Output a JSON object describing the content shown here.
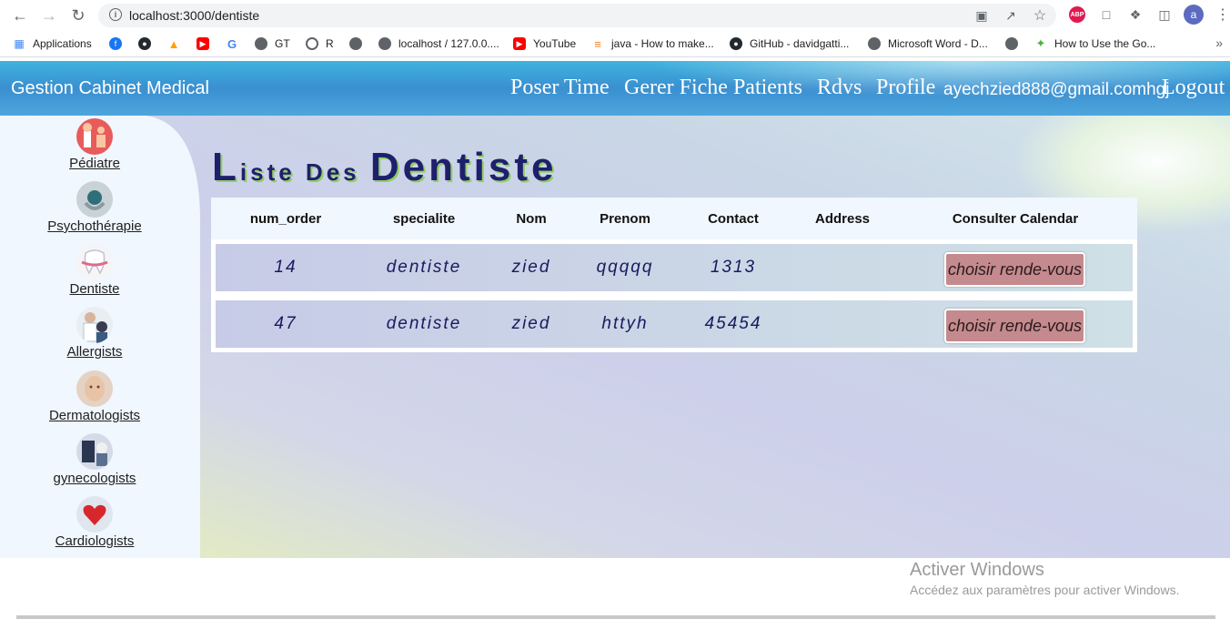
{
  "browser": {
    "url": "localhost:3000/dentiste",
    "avatar_letter": "a",
    "abp_label": "ABP",
    "bookmarks": [
      {
        "label": "Applications",
        "icon": "apps-grid-icon"
      },
      {
        "label": "",
        "icon": "facebook-icon"
      },
      {
        "label": "",
        "icon": "github-icon"
      },
      {
        "label": "",
        "icon": "firebase-icon"
      },
      {
        "label": "",
        "icon": "youtube-icon"
      },
      {
        "label": "",
        "icon": "google-icon"
      },
      {
        "label": "GT",
        "icon": "globe-icon"
      },
      {
        "label": "R",
        "icon": "r-icon"
      },
      {
        "label": "",
        "icon": "globe-icon"
      },
      {
        "label": "localhost / 127.0.0....",
        "icon": "globe-icon"
      },
      {
        "label": "YouTube",
        "icon": "youtube-icon"
      },
      {
        "label": "java - How to make...",
        "icon": "stackoverflow-icon"
      },
      {
        "label": "GitHub - davidgatti...",
        "icon": "github-icon"
      },
      {
        "label": "Microsoft Word - D...",
        "icon": "globe-icon"
      },
      {
        "label": "",
        "icon": "globe-icon"
      },
      {
        "label": "How to Use the Go...",
        "icon": "mongodb-leaf-icon"
      }
    ]
  },
  "navbar": {
    "brand": "Gestion Cabinet Medical",
    "links": [
      "Poser Time",
      "Gerer Fiche Patients",
      "Rdvs",
      "Profile"
    ],
    "email": "ayechzied888@gmail.comhgj",
    "logout": "Logout"
  },
  "sidebar": {
    "items": [
      {
        "label": "Pédiatre",
        "icon": "pediatrician-icon"
      },
      {
        "label": "Psychothérapie",
        "icon": "psychotherapy-icon"
      },
      {
        "label": "Dentiste",
        "icon": "tooth-icon"
      },
      {
        "label": "Allergists",
        "icon": "allergist-icon"
      },
      {
        "label": "Dermatologists",
        "icon": "dermatology-icon"
      },
      {
        "label": "gynecologists",
        "icon": "gynecology-icon"
      },
      {
        "label": "Cardiologists",
        "icon": "heart-icon"
      }
    ]
  },
  "main": {
    "title_parts": [
      "L",
      "iste Des ",
      "D",
      "entiste"
    ],
    "columns": [
      "num_order",
      "specialite",
      "Nom",
      "Prenom",
      "Contact",
      "Address",
      "Consulter Calendar"
    ],
    "rows": [
      {
        "num_order": "14",
        "specialite": "dentiste",
        "nom": "zied",
        "prenom": "qqqqq",
        "contact": "1313",
        "address": "",
        "button": "choisir rende-vous"
      },
      {
        "num_order": "47",
        "specialite": "dentiste",
        "nom": "zied",
        "prenom": "httyh",
        "contact": "45454",
        "address": "",
        "button": "choisir rende-vous"
      }
    ]
  },
  "windows": {
    "line1": "Activer Windows",
    "line2": "Accédez aux paramètres pour activer Windows."
  },
  "colors": {
    "navbar": "#3a8fd0",
    "sidebar": "#f0f7fe",
    "title": "#1f1f6e",
    "button": "#c48a8e"
  }
}
